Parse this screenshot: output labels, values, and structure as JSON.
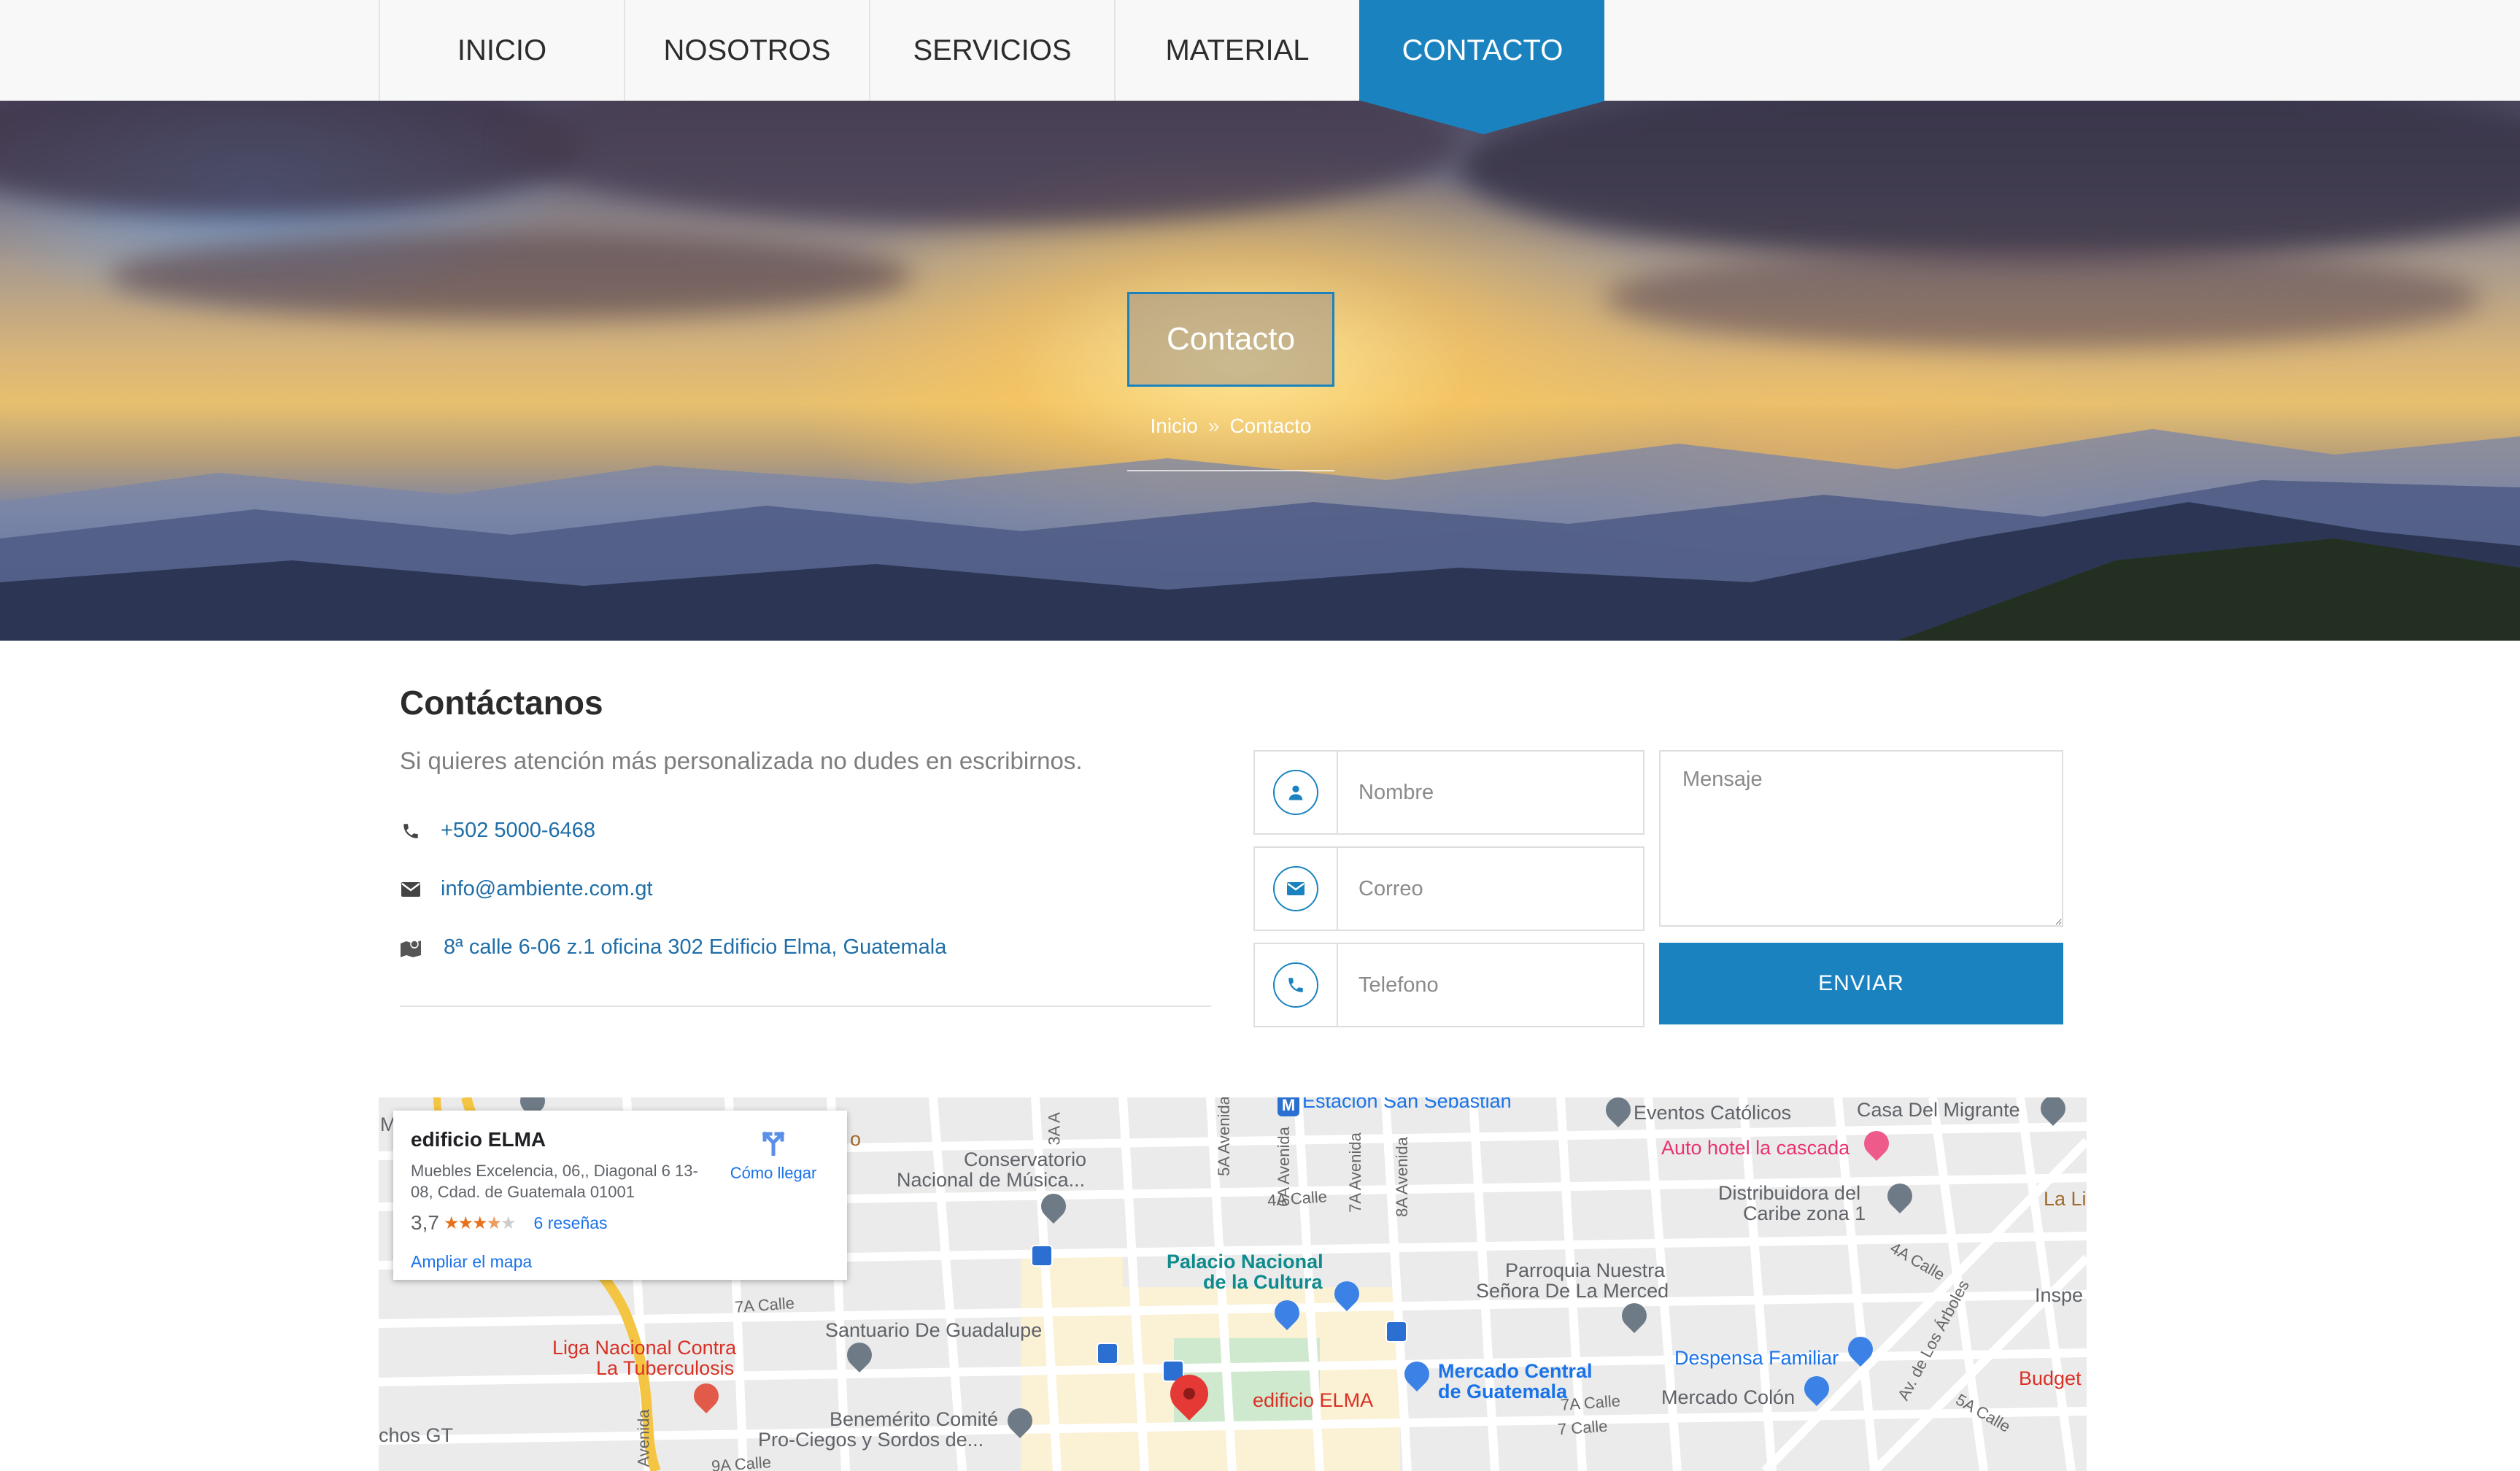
{
  "nav": {
    "items": [
      {
        "label": "INICIO",
        "active": false
      },
      {
        "label": "NOSOTROS",
        "active": false
      },
      {
        "label": "SERVICIOS",
        "active": false
      },
      {
        "label": "MATERIAL",
        "active": false
      },
      {
        "label": "CONTACTO",
        "active": true
      }
    ]
  },
  "hero": {
    "title": "Contacto",
    "breadcrumb": {
      "home": "Inicio",
      "separator": "»",
      "current": "Contacto"
    }
  },
  "contact": {
    "heading": "Contáctanos",
    "subtitle": "Si quieres atención más personalizada no dudes en escribirnos.",
    "phone": "+502 5000-6468",
    "email": "info@ambiente.com.gt",
    "address": "8ª calle 6-06 z.1 oficina 302 Edificio Elma, Guatemala",
    "icons": {
      "phone": "phone-icon",
      "email": "envelope-icon",
      "address": "map-icon"
    }
  },
  "form": {
    "name_placeholder": "Nombre",
    "email_placeholder": "Correo",
    "phone_placeholder": "Telefono",
    "message_placeholder": "Mensaje",
    "submit_label": "ENVIAR",
    "icons": {
      "name": "user-icon",
      "email": "envelope-icon",
      "phone": "phone-icon"
    }
  },
  "map": {
    "card": {
      "title": "edificio ELMA",
      "address": "Muebles Excelencia, 06,, Diagonal 6 13-08, Cdad. de Guatemala 01001",
      "rating": "3,7",
      "stars": 3.7,
      "reviews": "6 reseñas",
      "directions": "Cómo llegar",
      "enlarge": "Ampliar el mapa"
    },
    "labels": {
      "estacion": "Estación San Sebastián",
      "eventos": "Eventos Católicos",
      "casa_migrante": "Casa Del Migrante",
      "auto_hotel": "Auto hotel la cascada",
      "conservatorio_1": "Conservatorio",
      "conservatorio_2": "Nacional de Música...",
      "distribuidora_1": "Distribuidora del",
      "distribuidora_2": "Caribe zona 1",
      "la_li": "La Li",
      "palacio_1": "Palacio Nacional",
      "palacio_2": "de la Cultura",
      "parroquia_1": "Parroquia Nuestra",
      "parroquia_2": "Señora De La Merced",
      "inspe": "Inspe",
      "santuario": "Santuario De Guadalupe",
      "liga_1": "Liga Nacional Contra",
      "liga_2": "La Tuberculosis",
      "despensa": "Despensa Familiar",
      "mercado_1": "Mercado Central",
      "mercado_2": "de Guatemala",
      "budget": "Budget",
      "edificio": "edificio ELMA",
      "mercado_colon": "Mercado Colón",
      "benemerito_1": "Benemérito Comité",
      "benemerito_2": "Pro-Ciegos y Sordos de...",
      "chos": "chos GT",
      "s_4a_calle": "4A Calle",
      "s_7a_calle": "7A Calle",
      "s_7_calle": "7 Calle",
      "s_5a_calle": "5A Calle",
      "s_4a_calle_2": "4A Calle",
      "s_7a_calle_2": "7A Calle",
      "s_9a_calle": "9A Calle",
      "s_3a": "3A A",
      "s_5a_av": "5A Avenida",
      "s_6a_av": "6A Avenida",
      "s_7a_av": "7A Avenida",
      "s_8a_av": "8A Avenida",
      "s_avenida": "Avenida",
      "s_av_arboles": "Av. de Los Árboles",
      "s_m": "M",
      "s_o": "o"
    }
  }
}
